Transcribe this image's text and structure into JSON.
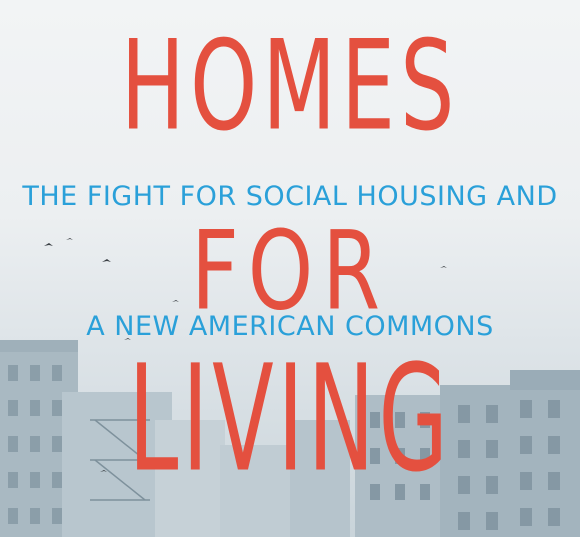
{
  "cover": {
    "title_line1": "HOMES",
    "title_line2": "FOR",
    "title_line3": "LIVING",
    "subtitle_line1": "THE FIGHT FOR SOCIAL HOUSING AND",
    "subtitle_line2": "A NEW AMERICAN COMMONS"
  },
  "colors": {
    "title": "#e4503f",
    "subtitle": "#2aa0d9",
    "sky": "#eceff1",
    "buildings": "#a8b8c1"
  }
}
